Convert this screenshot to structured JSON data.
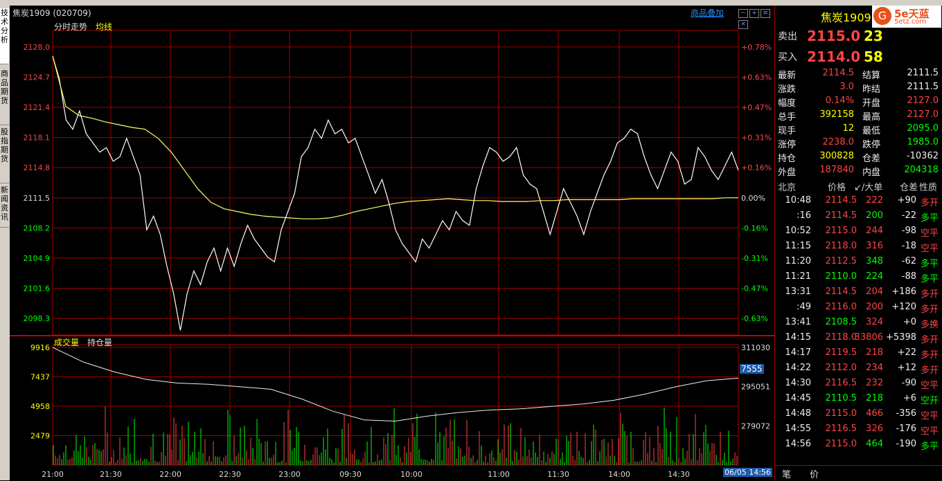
{
  "sidebar": {
    "tabs": [
      "技术分析",
      "商品期货",
      "股指期货",
      "新闻资讯"
    ]
  },
  "header": {
    "symbol_title": "焦炭1909 (020709)",
    "overlay_button": "商品叠加",
    "tabs": [
      "分时走势",
      "均线"
    ],
    "volume_tabs": [
      "成交量",
      "持仓量"
    ]
  },
  "price_axis": {
    "left": [
      "2128.0",
      "2124.7",
      "2121.4",
      "2118.1",
      "2114.8",
      "2111.5",
      "2108.2",
      "2104.9",
      "2101.6",
      "2098.3"
    ],
    "right": [
      "+0.78%",
      "+0.63%",
      "+0.47%",
      "+0.31%",
      "+0.16%",
      "0.00%",
      "-0.16%",
      "-0.31%",
      "-0.47%",
      "-0.63%"
    ]
  },
  "volume_axis": {
    "left": [
      "9916",
      "7437",
      "4958",
      "2479"
    ],
    "right": [
      "311030",
      "295051",
      "279072"
    ],
    "current_value": "7555"
  },
  "time_axis": [
    "21:00",
    "21:30",
    "22:00",
    "22:30",
    "23:00",
    "09:30",
    "10:00",
    "11:00",
    "11:30",
    "14:00",
    "14:30"
  ],
  "current_time": "06/05 14:56",
  "colors": {
    "up": "#ff4444",
    "down": "#00ff00",
    "grid": "#a00000",
    "price_line": "#ffffff",
    "avg_line": "#ffff66"
  },
  "chart_data": {
    "type": "line",
    "title": "焦炭1909 (020709)",
    "prev_settle": 2111.5,
    "ylim": [
      2096.5,
      2129.5
    ],
    "x_categories": [
      "21:00",
      "21:30",
      "22:00",
      "22:30",
      "23:00",
      "09:30",
      "10:00",
      "11:00",
      "11:30",
      "14:00",
      "14:30",
      "14:56"
    ],
    "series": [
      {
        "name": "分时走势",
        "values": [
          2127.0,
          2124.5,
          2120.0,
          2119.0,
          2121.0,
          2118.5,
          2117.5,
          2116.5,
          2117.0,
          2115.5,
          2116.0,
          2118.0,
          2116.0,
          2114.0,
          2108.0,
          2109.5,
          2107.5,
          2104.0,
          2101.0,
          2097.0,
          2101.0,
          2103.5,
          2102.0,
          2104.5,
          2106.0,
          2103.5,
          2106.0,
          2104.0,
          2106.5,
          2108.5,
          2107.0,
          2106.0,
          2105.0,
          2104.5,
          2108.0,
          2110.0,
          2112.0,
          2116.0,
          2117.0,
          2119.0,
          2118.0,
          2120.0,
          2118.5,
          2119.0,
          2117.5,
          2118.0,
          2116.0,
          2114.0,
          2112.0,
          2113.5,
          2111.0,
          2108.0,
          2106.5,
          2105.5,
          2104.5,
          2107.0,
          2106.0,
          2107.5,
          2109.0,
          2108.0,
          2110.0,
          2109.0,
          2108.5,
          2112.5,
          2115.0,
          2117.0,
          2116.5,
          2115.5,
          2116.0,
          2117.0,
          2114.0,
          2113.0,
          2112.5,
          2110.0,
          2107.5,
          2110.0,
          2112.5,
          2111.0,
          2109.5,
          2107.5,
          2110.0,
          2112.0,
          2114.0,
          2115.5,
          2117.5,
          2118.0,
          2119.0,
          2118.5,
          2116.0,
          2114.0,
          2112.5,
          2114.5,
          2116.5,
          2115.5,
          2113.0,
          2113.5,
          2117.0,
          2116.0,
          2114.5,
          2113.5,
          2115.0,
          2116.5,
          2114.5
        ]
      },
      {
        "name": "均线",
        "values": [
          2127.0,
          2121.5,
          2120.5,
          2120.2,
          2119.8,
          2119.5,
          2119.2,
          2119.0,
          2118.0,
          2116.5,
          2114.5,
          2112.5,
          2111.0,
          2110.3,
          2110.0,
          2109.7,
          2109.5,
          2109.4,
          2109.3,
          2109.2,
          2109.2,
          2109.3,
          2109.6,
          2110.0,
          2110.3,
          2110.6,
          2110.9,
          2111.1,
          2111.2,
          2111.3,
          2111.4,
          2111.3,
          2111.2,
          2111.2,
          2111.1,
          2111.1,
          2111.1,
          2111.2,
          2111.2,
          2111.3,
          2111.3,
          2111.3,
          2111.3,
          2111.3,
          2111.4,
          2111.4,
          2111.4,
          2111.4,
          2111.4,
          2111.4,
          2111.4,
          2111.5,
          2111.5
        ]
      }
    ]
  },
  "volume_chart": {
    "type": "bar",
    "ylim": [
      0,
      9916
    ],
    "open_interest_ylim": [
      263093,
      311030
    ]
  },
  "quote": {
    "title": "焦炭1909 (",
    "sell_label": "卖出",
    "sell_price": "2115.0",
    "sell_qty": "23",
    "buy_label": "买入",
    "buy_price": "2114.0",
    "buy_qty": "58",
    "stats": [
      {
        "l1": "最新",
        "v1": "2114.5",
        "c1": "red",
        "l2": "结算",
        "v2": "2111.5",
        "c2": "wht"
      },
      {
        "l1": "涨跌",
        "v1": "3.0",
        "c1": "red",
        "l2": "昨结",
        "v2": "2111.5",
        "c2": "wht"
      },
      {
        "l1": "幅度",
        "v1": "0.14%",
        "c1": "red",
        "l2": "开盘",
        "v2": "2127.0",
        "c2": "red"
      },
      {
        "l1": "总手",
        "v1": "392158",
        "c1": "yel",
        "l2": "最高",
        "v2": "2127.0",
        "c2": "red"
      },
      {
        "l1": "现手",
        "v1": "12",
        "c1": "yel",
        "l2": "最低",
        "v2": "2095.0",
        "c2": "grn"
      },
      {
        "l1": "涨停",
        "v1": "2238.0",
        "c1": "red",
        "l2": "跌停",
        "v2": "1985.0",
        "c2": "grn"
      },
      {
        "l1": "持仓",
        "v1": "300828",
        "c1": "yel",
        "l2": "仓差",
        "v2": "-10362",
        "c2": "wht"
      },
      {
        "l1": "外盘",
        "v1": "187840",
        "c1": "red",
        "l2": "内盘",
        "v2": "204318",
        "c2": "grn"
      }
    ]
  },
  "trades_header": [
    "北京",
    "价格",
    "↙/大单",
    "仓差",
    "性质"
  ],
  "trades": [
    {
      "time": "10:48",
      "price": "2114.5",
      "pc": "red",
      "vol": "222",
      "vc": "red",
      "oi": "+90",
      "nature": "多开",
      "nc": "red"
    },
    {
      "time": ":16",
      "price": "2114.5",
      "pc": "red",
      "vol": "200",
      "vc": "grn",
      "oi": "-22",
      "nature": "多平",
      "nc": "grn"
    },
    {
      "time": "10:52",
      "price": "2115.0",
      "pc": "red",
      "vol": "244",
      "vc": "red",
      "oi": "-98",
      "nature": "空平",
      "nc": "red"
    },
    {
      "time": "11:15",
      "price": "2118.0",
      "pc": "red",
      "vol": "316",
      "vc": "red",
      "oi": "-18",
      "nature": "空平",
      "nc": "red"
    },
    {
      "time": "11:20",
      "price": "2112.5",
      "pc": "red",
      "vol": "348",
      "vc": "grn",
      "oi": "-62",
      "nature": "多平",
      "nc": "grn"
    },
    {
      "time": "11:21",
      "price": "2110.0",
      "pc": "grn",
      "vol": "224",
      "vc": "grn",
      "oi": "-88",
      "nature": "多平",
      "nc": "grn"
    },
    {
      "time": "13:31",
      "price": "2114.5",
      "pc": "red",
      "vol": "204",
      "vc": "red",
      "oi": "+186",
      "nature": "多开",
      "nc": "red"
    },
    {
      "time": ":49",
      "price": "2116.0",
      "pc": "red",
      "vol": "200",
      "vc": "red",
      "oi": "+120",
      "nature": "多开",
      "nc": "red"
    },
    {
      "time": "13:41",
      "price": "2108.5",
      "pc": "grn",
      "vol": "324",
      "vc": "red",
      "oi": "+0",
      "nature": "多换",
      "nc": "red"
    },
    {
      "time": "14:15",
      "price": "2118.0",
      "pc": "red",
      "vol": "33806",
      "vc": "red",
      "oi": "+5398",
      "nature": "多开",
      "nc": "red"
    },
    {
      "time": "14:17",
      "price": "2119.5",
      "pc": "red",
      "vol": "218",
      "vc": "red",
      "oi": "+22",
      "nature": "多开",
      "nc": "red"
    },
    {
      "time": "14:22",
      "price": "2112.0",
      "pc": "red",
      "vol": "234",
      "vc": "red",
      "oi": "+12",
      "nature": "多开",
      "nc": "red"
    },
    {
      "time": "14:30",
      "price": "2116.5",
      "pc": "red",
      "vol": "232",
      "vc": "red",
      "oi": "-90",
      "nature": "空平",
      "nc": "red"
    },
    {
      "time": "14:45",
      "price": "2110.5",
      "pc": "grn",
      "vol": "218",
      "vc": "grn",
      "oi": "+6",
      "nature": "空开",
      "nc": "grn"
    },
    {
      "time": "14:48",
      "price": "2115.0",
      "pc": "red",
      "vol": "466",
      "vc": "red",
      "oi": "-356",
      "nature": "空平",
      "nc": "red"
    },
    {
      "time": "14:55",
      "price": "2116.5",
      "pc": "red",
      "vol": "326",
      "vc": "red",
      "oi": "-176",
      "nature": "空平",
      "nc": "red"
    },
    {
      "time": "14:56",
      "price": "2115.0",
      "pc": "red",
      "vol": "464",
      "vc": "grn",
      "oi": "-190",
      "nature": "多平",
      "nc": "grn"
    }
  ],
  "bottom_tabs": [
    "笔",
    "价"
  ],
  "logo": {
    "text1": "5e天蓝",
    "text2": "5etz.com"
  }
}
